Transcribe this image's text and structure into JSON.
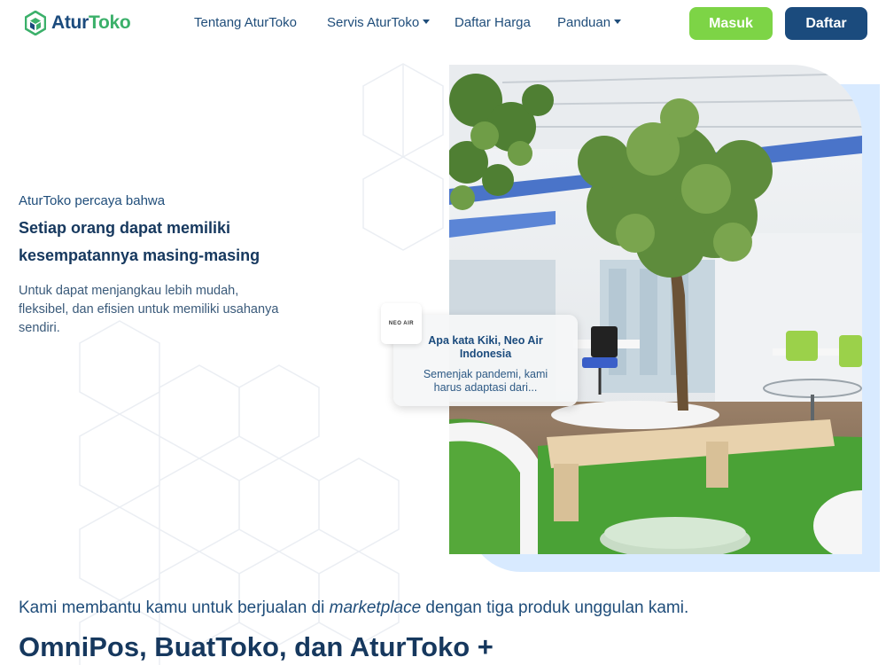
{
  "brand": {
    "name_part1": "Atur",
    "name_part2": "Toko",
    "logo_icon": "hexagon-box-icon",
    "color_primary": "#1b4b7d",
    "color_accent": "#3bb06a"
  },
  "nav": {
    "links": [
      {
        "label": "Tentang AturToko"
      },
      {
        "label": "Servis AturToko"
      },
      {
        "label": "Daftar Harga"
      },
      {
        "label": "Panduan"
      }
    ],
    "login_label": "Masuk",
    "register_label": "Daftar",
    "login_color": "#7dd446",
    "register_color": "#1b4b7d"
  },
  "hero": {
    "kicker": "AturToko percaya bahwa",
    "title": "Setiap orang dapat memiliki kesempatannya masing-masing",
    "description": "Untuk dapat menjangkau lebih mudah, fleksibel, dan efisien untuk memiliki usahanya sendiri."
  },
  "testimonial": {
    "logo_text": "NEO AIR",
    "title": "Apa kata Kiki, Neo Air Indonesia",
    "quote": "Semenjak pandemi, kami harus adaptasi dari..."
  },
  "products": {
    "lead_before": "Kami membantu kamu untuk berjualan di ",
    "lead_italic": "marketplace",
    "lead_after": " dengan tiga produk unggulan kami.",
    "title": "OmniPos, BuatToko, dan AturToko +"
  }
}
